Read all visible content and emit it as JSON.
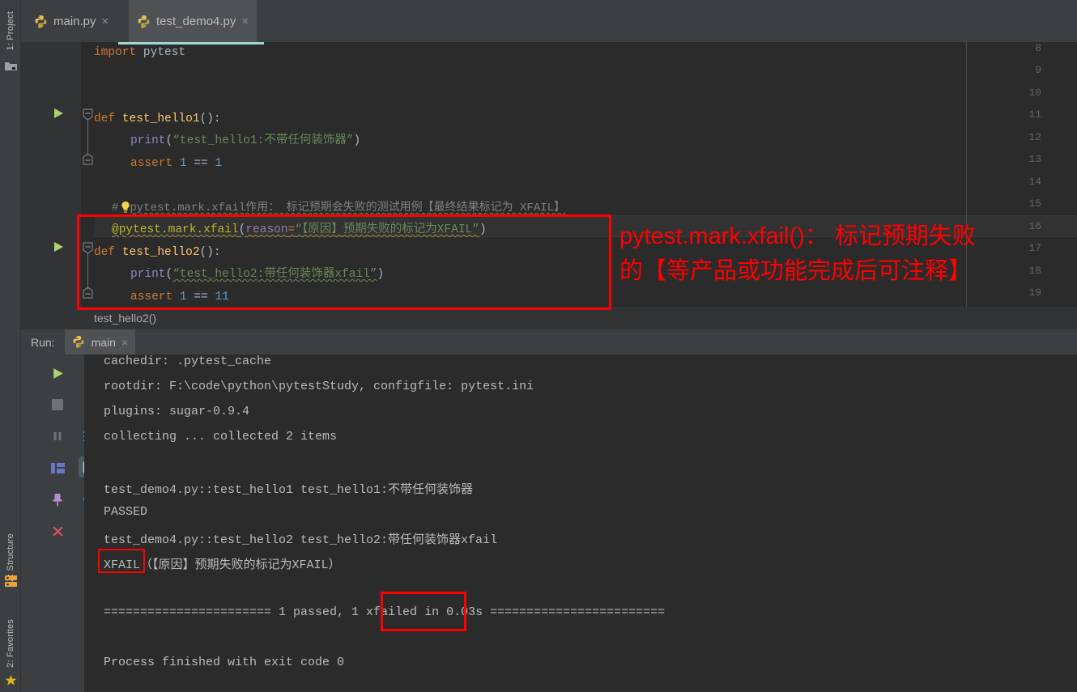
{
  "window": {
    "theme_bg": "#2b2b2b",
    "panel_bg": "#3c3f41",
    "accent_red": "#ff0000"
  },
  "left_strip": {
    "top_items": [
      {
        "label": "1: Project",
        "icon": "project-folder-icon"
      }
    ],
    "bottom_items": [
      {
        "label": "Z: Structure",
        "icon": "structure-icon"
      },
      {
        "label": "2: Favorites",
        "icon": "star-icon"
      }
    ]
  },
  "tabs": [
    {
      "label": "main.py",
      "icon": "python-file-icon",
      "active": false,
      "close": "×"
    },
    {
      "label": "test_demo4.py",
      "icon": "python-file-icon",
      "active": true,
      "close": "×"
    }
  ],
  "editor": {
    "lines": [
      {
        "n": "8",
        "text": "import pytest"
      },
      {
        "n": "9",
        "text": ""
      },
      {
        "n": "10",
        "text": ""
      },
      {
        "n": "11",
        "text": "def test_hello1():"
      },
      {
        "n": "12",
        "text": "    print(“test_hello1:不带任何装饰器”)"
      },
      {
        "n": "13",
        "text": "    assert 1 == 1"
      },
      {
        "n": "14",
        "text": ""
      },
      {
        "n": "15",
        "text": "#pytest.mark.xfail作用： 标记预期会失败的测试用例【最终结果标记为 XFAIL】"
      },
      {
        "n": "16",
        "text": "@pytest.mark.xfail(reason=“【原因】预期失败的标记为XFAIL”)"
      },
      {
        "n": "17",
        "text": "def test_hello2():"
      },
      {
        "n": "18",
        "text": "    print(“test_hello2:带任何装饰器xfail”)"
      },
      {
        "n": "19",
        "text": "    assert 1 == 11"
      }
    ],
    "tokens": {
      "kw_import": "import",
      "mod_pytest": "pytest",
      "kw_def": "def",
      "fn_hello1": "test_hello1",
      "fn_hello2": "test_hello2",
      "paren_empty": "():",
      "fn_print": "print",
      "str_print1": "“test_hello1:不带任何装饰器”",
      "str_print2": "“test_hello2:带任何装饰器xfail”",
      "kw_assert": "assert",
      "num_1": "1",
      "op_eq": "==",
      "num_11": "11",
      "comment15": "#pytest.mark.xfail作用： 标记预期会失败的测试用例【最终结果标记为 XFAIL】",
      "comment15_hash": "#",
      "comment15_rest": "pytest.mark.xfail作用： 标记预期会失败的测试用例【最终结果标记为 XFAIL】",
      "dec_name": "@pytest.mark.xfail",
      "dec_open": "(",
      "dec_kwarg": "reason",
      "dec_assign": "=",
      "dec_str": "“【原因】预期失败的标记为XFAIL”",
      "dec_close": ")"
    }
  },
  "breadcrumb": {
    "path": "test_hello2()"
  },
  "run_panel": {
    "label": "Run:",
    "tab_label": "main",
    "tab_icon": "python-file-icon",
    "tab_close": "×",
    "tools": [
      {
        "name": "rerun-button",
        "icon": "play-icon"
      },
      {
        "name": "scroll-up-button",
        "icon": "arrow-up-icon"
      },
      {
        "name": "stop-button",
        "icon": "stop-square-icon"
      },
      {
        "name": "scroll-down-button",
        "icon": "arrow-down-icon"
      },
      {
        "name": "pause-button",
        "icon": "pause-icon"
      },
      {
        "name": "soft-wrap-button",
        "icon": "soft-wrap-icon"
      },
      {
        "name": "layout-button",
        "icon": "layout-icon"
      },
      {
        "name": "scroll-to-end-button",
        "icon": "scroll-to-end-icon"
      },
      {
        "name": "pin-tab-button",
        "icon": "pin-icon"
      },
      {
        "name": "print-button",
        "icon": "printer-icon"
      },
      {
        "name": "close-button",
        "icon": "close-x-icon"
      },
      {
        "name": "clear-all-button",
        "icon": "trash-icon"
      }
    ]
  },
  "console": {
    "lines": [
      "cachedir: .pytest_cache",
      "rootdir: F:\\code\\python\\pytestStudy, configfile: pytest.ini",
      "plugins: sugar-0.9.4",
      "collecting ... collected 2 items",
      "",
      "test_demo4.py::test_hello1 test_hello1:不带任何装饰器",
      "PASSED",
      "test_demo4.py::test_hello2 test_hello2:带任何装饰器xfail",
      "XFAIL（【原因】预期失败的标记为XFAIL）",
      "",
      "======================= 1 passed, 1 xfailed in 0.03s ========================",
      "",
      "Process finished with exit code 0"
    ],
    "highlight_xfail": "XFAIL",
    "highlight_xfailed": "1 xfailed"
  },
  "annotation": {
    "line1": "pytest.mark.xfail()： 标记预期失败",
    "line2": "的【等产品或功能完成后可注释】",
    "color": "#ff0000"
  }
}
